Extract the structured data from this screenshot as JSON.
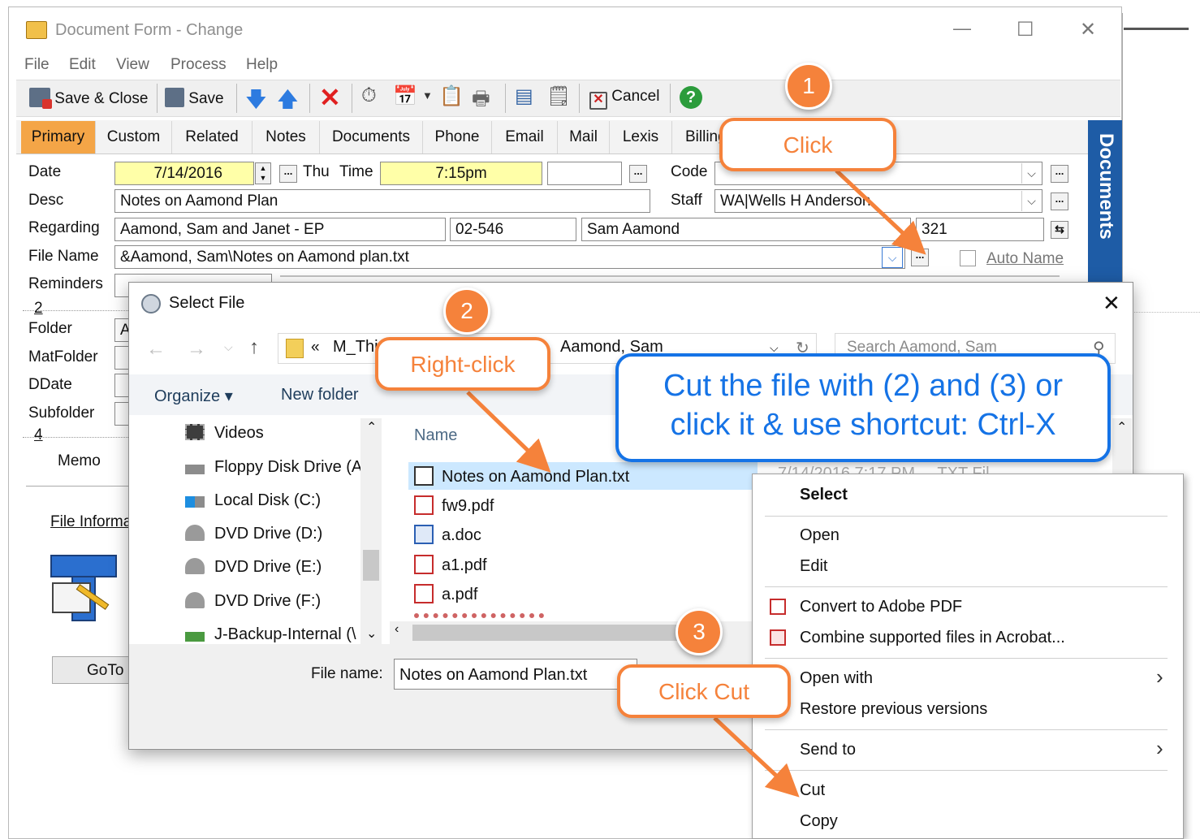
{
  "window": {
    "title": "Document Form - Change",
    "min": "—",
    "max": "☐",
    "close": "✕"
  },
  "menu": [
    "File",
    "Edit",
    "View",
    "Process",
    "Help"
  ],
  "toolbar": {
    "save_close": "Save & Close",
    "save": "Save",
    "cancel": "Cancel"
  },
  "tabs": [
    "Primary",
    "Custom",
    "Related",
    "Notes",
    "Documents",
    "Phone",
    "Email",
    "Mail",
    "Lexis",
    "Billing"
  ],
  "side_tab": "Documents",
  "form": {
    "date_label": "Date",
    "date_value": "7/14/2016",
    "day": "Thu",
    "time_label": "Time",
    "time_value": "7:15pm",
    "code_label": "Code",
    "desc_label": "Desc",
    "desc_value": "Notes on Aamond Plan",
    "staff_label": "Staff",
    "staff_value": "WA|Wells H Anderson",
    "regarding_label": "Regarding",
    "regarding_value": "Aamond, Sam and Janet - EP",
    "matter_no": "02-546",
    "client": "Sam Aamond",
    "number": "321",
    "filename_label": "File Name",
    "filename_value": "&Aamond, Sam\\Notes on Aamond plan.txt",
    "auto_name": "Auto Name",
    "reminders_label": "Reminders",
    "step2": "2",
    "folder_label": "Folder",
    "folder_value": "A",
    "matfolder_label": "MatFolder",
    "ddate_label": "DDate",
    "subfolder_label": "Subfolder",
    "step4": "4",
    "memo_label": "Memo",
    "file_info_label": "File Informa",
    "goto_label": "GoTo"
  },
  "dialog": {
    "title": "Select File",
    "close": "✕",
    "path_start": "«",
    "path_folder": "M_Thi",
    "path_current": "Aamond, Sam",
    "search_placeholder": "Search Aamond, Sam",
    "organize": "Organize ▾",
    "new_folder": "New folder",
    "nav": [
      "Videos",
      "Floppy Disk Drive (A",
      "Local Disk (C:)",
      "DVD Drive (D:)",
      "DVD Drive (E:)",
      "DVD Drive (F:)",
      "J-Backup-Internal (\\"
    ],
    "col_name": "Name",
    "files": [
      {
        "name": "Notes on Aamond Plan.txt",
        "type": "txt"
      },
      {
        "name": "fw9.pdf",
        "type": "pdf"
      },
      {
        "name": "a.doc",
        "type": "doc"
      },
      {
        "name": "a1.pdf",
        "type": "pdf"
      },
      {
        "name": "a.pdf",
        "type": "pdf"
      }
    ],
    "filename_label": "File name:",
    "filename_value": "Notes on Aamond Plan.txt"
  },
  "context_menu": {
    "items": [
      "Select",
      "Open",
      "Edit",
      "Convert to Adobe PDF",
      "Combine supported files in Acrobat...",
      "Open with",
      "Restore previous versions",
      "Send to",
      "Cut",
      "Copy"
    ]
  },
  "annotations": {
    "step1": "1",
    "click": "Click",
    "step2": "2",
    "right_click": "Right-click",
    "step3": "3",
    "click_cut": "Click Cut",
    "instruction_line1": "Cut the file with (2) and (3) or",
    "instruction_line2": "click it & use shortcut: Ctrl-X"
  },
  "colors": {
    "accent_orange": "#f5823b",
    "instruction_blue": "#1573e6",
    "tab_active": "#f4a547",
    "field_yellow": "#ffffa8",
    "side_tab_blue": "#1e5ca6"
  }
}
